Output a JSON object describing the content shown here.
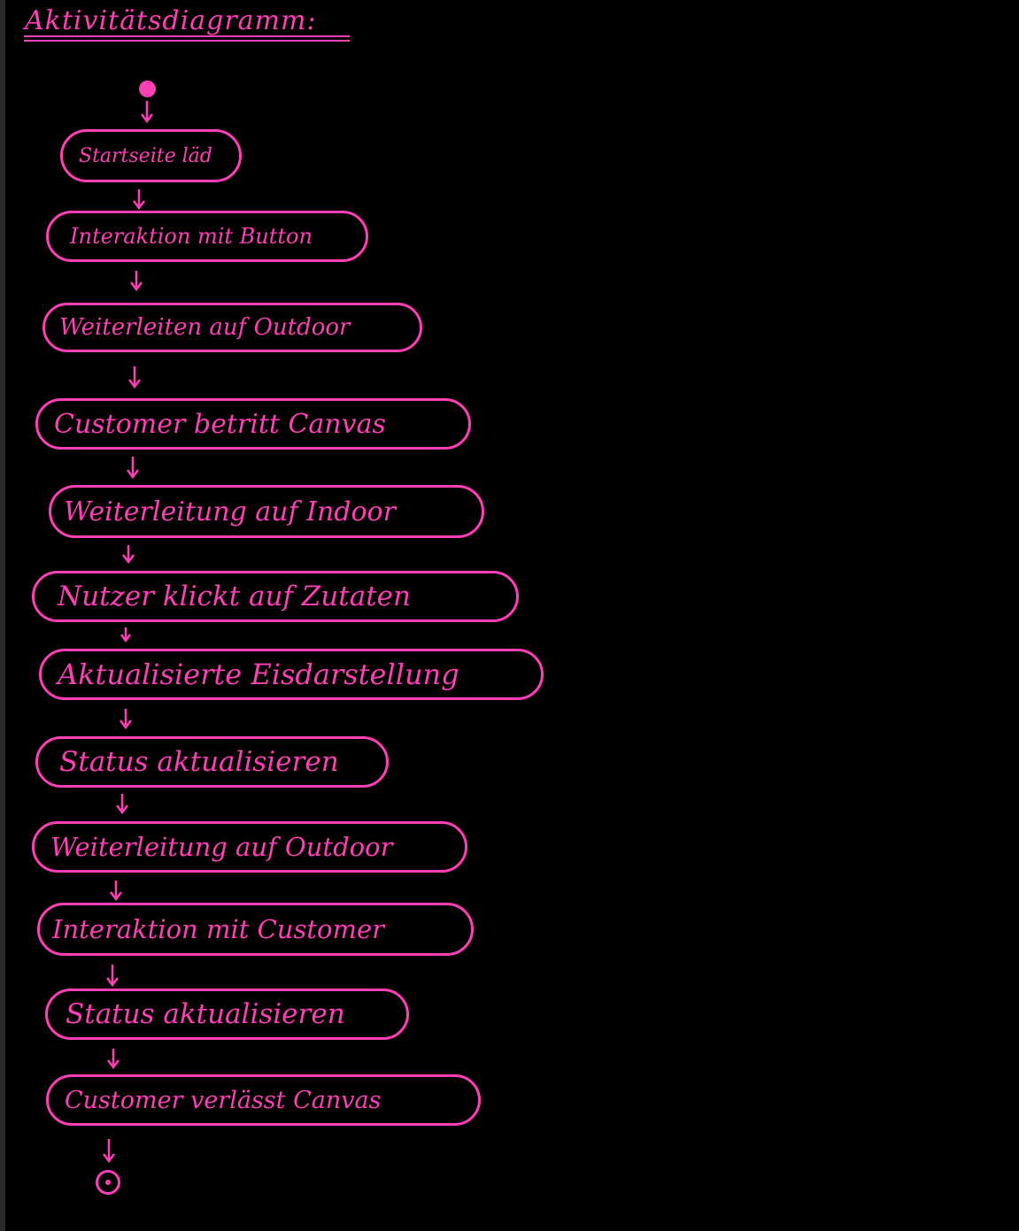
{
  "title": "Aktivitätsdiagramm:",
  "colors": {
    "background": "#000000",
    "ink": "#ff3fb6"
  },
  "diagram": {
    "type": "activity-diagram",
    "start": "initial-node",
    "end": "final-node",
    "actions": [
      "Startseite läd",
      "Interaktion mit Button",
      "Weiterleiten auf Outdoor",
      "Customer betritt Canvas",
      "Weiterleitung auf Indoor",
      "Nutzer klickt auf Zutaten",
      "Aktualisierte Eisdarstellung",
      "Status aktualisieren",
      "Weiterleitung auf Outdoor",
      "Interaktion mit Customer",
      "Status aktualisieren",
      "Customer verlässt Canvas"
    ]
  }
}
